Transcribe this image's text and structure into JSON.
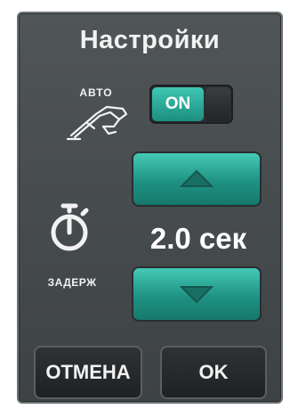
{
  "dialog": {
    "title": "Настройки",
    "auto_label": "АВТО",
    "toggle": {
      "state_label": "ON",
      "state": true
    },
    "delay": {
      "value_text": "2.0 сек",
      "label": "ЗАДЕРЖ"
    },
    "buttons": {
      "cancel_label": "ОТМЕНА",
      "ok_label": "OK"
    }
  },
  "colors": {
    "panel": "#45494b",
    "accent_teal": "#2aa896",
    "button_dark": "#262a2c",
    "text": "#f2f2f2"
  },
  "icons": [
    "auto-writing-hand-icon",
    "stopwatch-icon",
    "arrow-up-icon",
    "arrow-down-icon"
  ]
}
